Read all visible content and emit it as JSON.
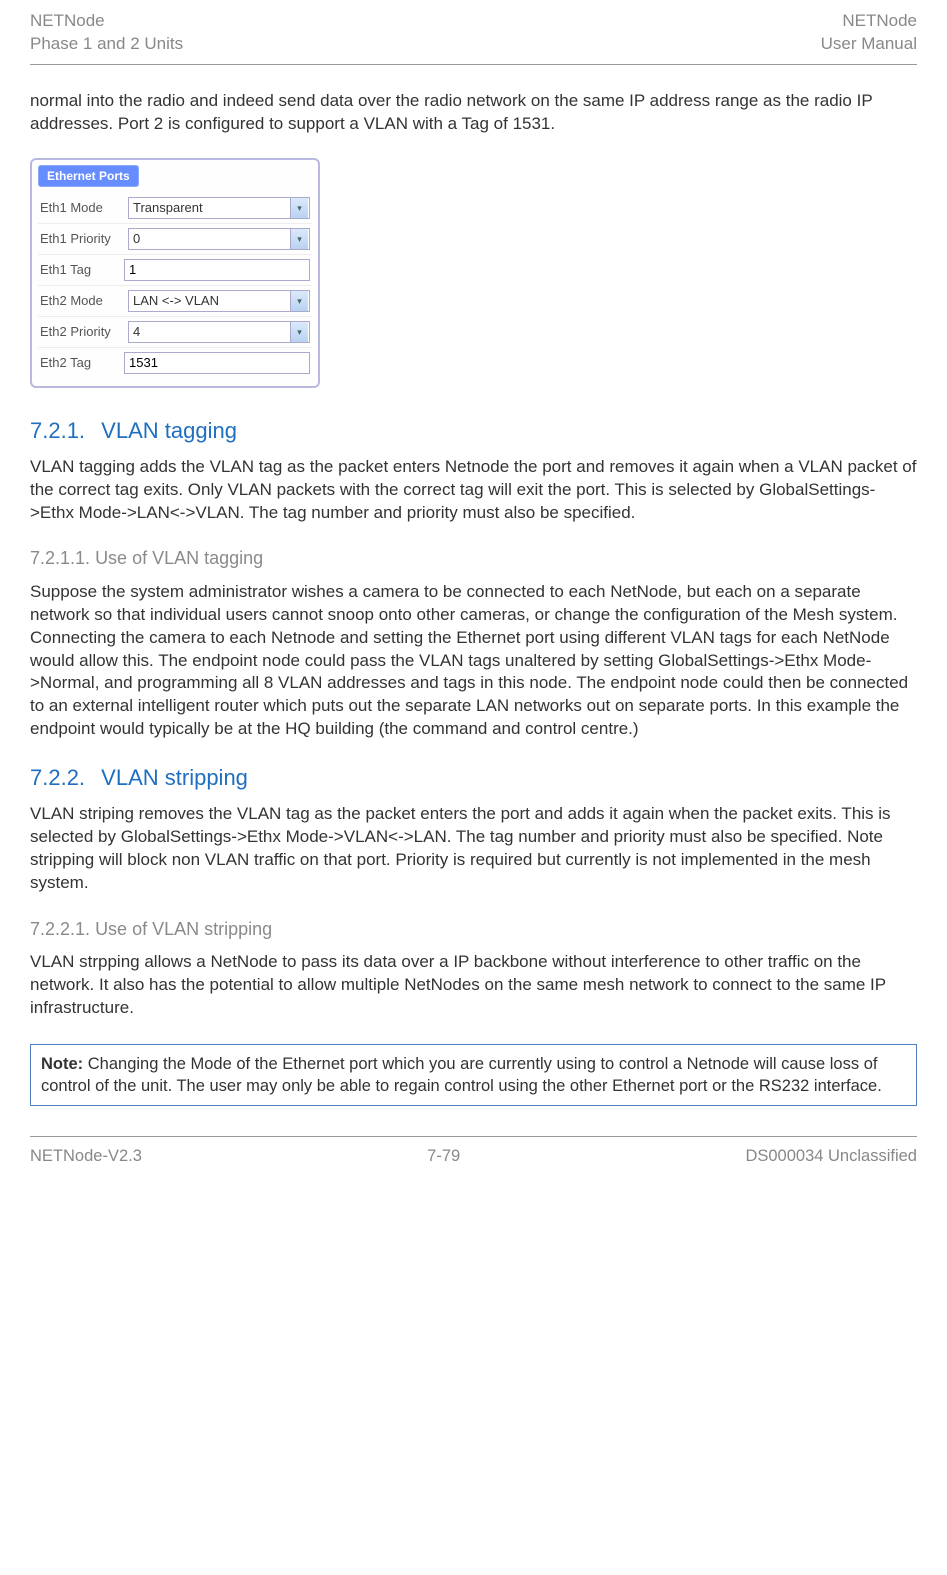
{
  "header": {
    "leftLine1": "NETNode",
    "leftLine2": "Phase 1 and 2 Units",
    "rightLine1": "NETNode",
    "rightLine2": "User Manual"
  },
  "intro": "normal into the radio and indeed send data over the radio network on the same IP address range as the radio IP addresses. Port 2 is configured to support a VLAN with a Tag of 1531.",
  "panel": {
    "title": "Ethernet Ports",
    "rows": [
      {
        "label": "Eth1 Mode",
        "value": "Transparent",
        "type": "select"
      },
      {
        "label": "Eth1 Priority",
        "value": "0",
        "type": "select"
      },
      {
        "label": "Eth1 Tag",
        "value": "1",
        "type": "input"
      },
      {
        "label": "Eth2 Mode",
        "value": "LAN <-> VLAN",
        "type": "select"
      },
      {
        "label": "Eth2 Priority",
        "value": "4",
        "type": "select"
      },
      {
        "label": "Eth2 Tag",
        "value": "1531",
        "type": "input"
      }
    ]
  },
  "s721": {
    "num": "7.2.1.",
    "title": "VLAN tagging",
    "body": "VLAN tagging adds the VLAN tag as the packet enters Netnode the port and removes it again when a VLAN packet of the correct tag exits. Only VLAN packets with the correct tag will exit the port. This is selected by GlobalSettings->Ethx Mode->LAN<->VLAN. The tag number and priority must also be specified."
  },
  "s7211": {
    "num": "7.2.1.1.",
    "title": "Use of VLAN tagging",
    "body": "Suppose the system administrator wishes a camera to be connected to each NetNode, but each on a separate network so that individual users cannot snoop onto other cameras, or change the configuration of the Mesh system. Connecting the camera to each Netnode and setting the Ethernet port using different VLAN tags for each NetNode would allow this. The endpoint node could pass the VLAN tags unaltered by setting GlobalSettings->Ethx Mode->Normal, and programming all 8 VLAN addresses and tags in this node. The endpoint node could then be connected to an external intelligent router which puts out the separate LAN networks out on separate ports. In this example the endpoint would typically be at the HQ building (the command and control centre.)"
  },
  "s722": {
    "num": "7.2.2.",
    "title": "VLAN stripping",
    "body": "VLAN striping removes the VLAN tag as the packet enters the port and adds it again when the packet exits. This is selected by GlobalSettings->Ethx Mode->VLAN<->LAN. The tag number and priority must also be specified. Note stripping will block non VLAN traffic on that port. Priority is required but currently is not implemented in the mesh system."
  },
  "s7221": {
    "num": "7.2.2.1.",
    "title": "Use of VLAN stripping",
    "body": "VLAN strpping allows a NetNode to pass its data over a IP backbone without interference to other traffic on the network. It also has the potential to allow multiple NetNodes on the same mesh network to connect to the same IP infrastructure."
  },
  "note": {
    "label": "Note:",
    "body": " Changing the Mode of the Ethernet port which you are currently using to control a Netnode will cause loss of control of the unit. The user may only be able to regain control using the other Ethernet port or the RS232 interface."
  },
  "footer": {
    "left": "NETNode-V2.3",
    "center": "7-79",
    "right": "DS000034 Unclassified"
  }
}
